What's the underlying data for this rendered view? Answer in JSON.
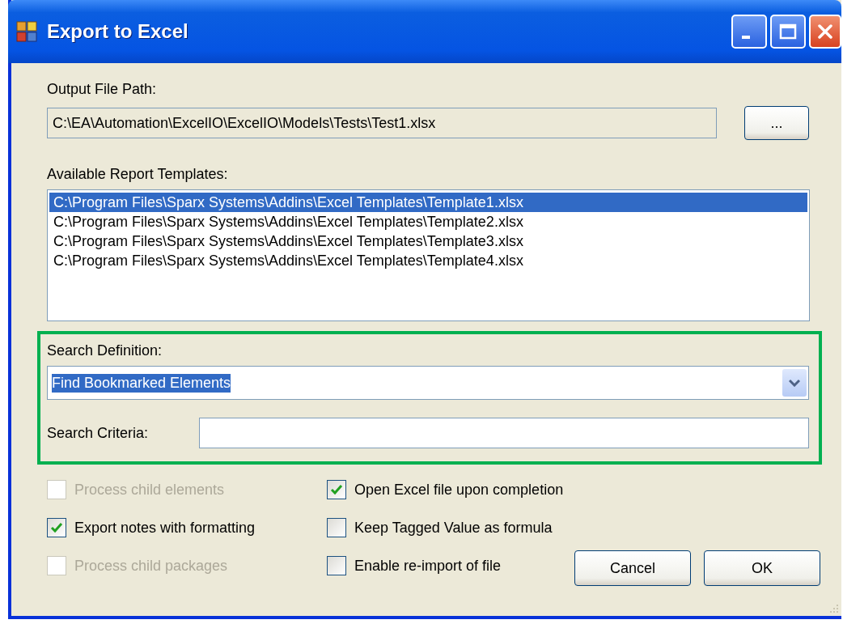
{
  "window": {
    "title": "Export to Excel"
  },
  "output_path": {
    "label": "Output File Path:",
    "value": "C:\\EA\\Automation\\ExcelIO\\ExcelIO\\Models\\Tests\\Test1.xlsx",
    "browse_button": "..."
  },
  "templates": {
    "label": "Available Report Templates:",
    "items": [
      {
        "text": "C:\\Program Files\\Sparx Systems\\Addins\\Excel Templates\\Template1.xlsx",
        "selected": true
      },
      {
        "text": "C:\\Program Files\\Sparx Systems\\Addins\\Excel Templates\\Template2.xlsx",
        "selected": false
      },
      {
        "text": "C:\\Program Files\\Sparx Systems\\Addins\\Excel Templates\\Template3.xlsx",
        "selected": false
      },
      {
        "text": "C:\\Program Files\\Sparx Systems\\Addins\\Excel Templates\\Template4.xlsx",
        "selected": false
      }
    ]
  },
  "search_definition": {
    "label": "Search Definition:",
    "value": "Find Bookmarked Elements",
    "value_selected": true
  },
  "search_criteria": {
    "label": "Search Criteria:"
  },
  "options_left": [
    {
      "label": "Process child elements",
      "checked": false,
      "disabled": true
    },
    {
      "label": "Export notes with formatting",
      "checked": true,
      "disabled": false
    },
    {
      "label": "Process child packages",
      "checked": false,
      "disabled": true
    }
  ],
  "options_right": [
    {
      "label": "Open Excel file upon completion",
      "checked": true,
      "disabled": false
    },
    {
      "label": "Keep Tagged Value as formula",
      "checked": false,
      "disabled": false
    },
    {
      "label": "Enable re-import of file",
      "checked": false,
      "disabled": false
    }
  ],
  "buttons": [
    "Cancel",
    "OK"
  ]
}
